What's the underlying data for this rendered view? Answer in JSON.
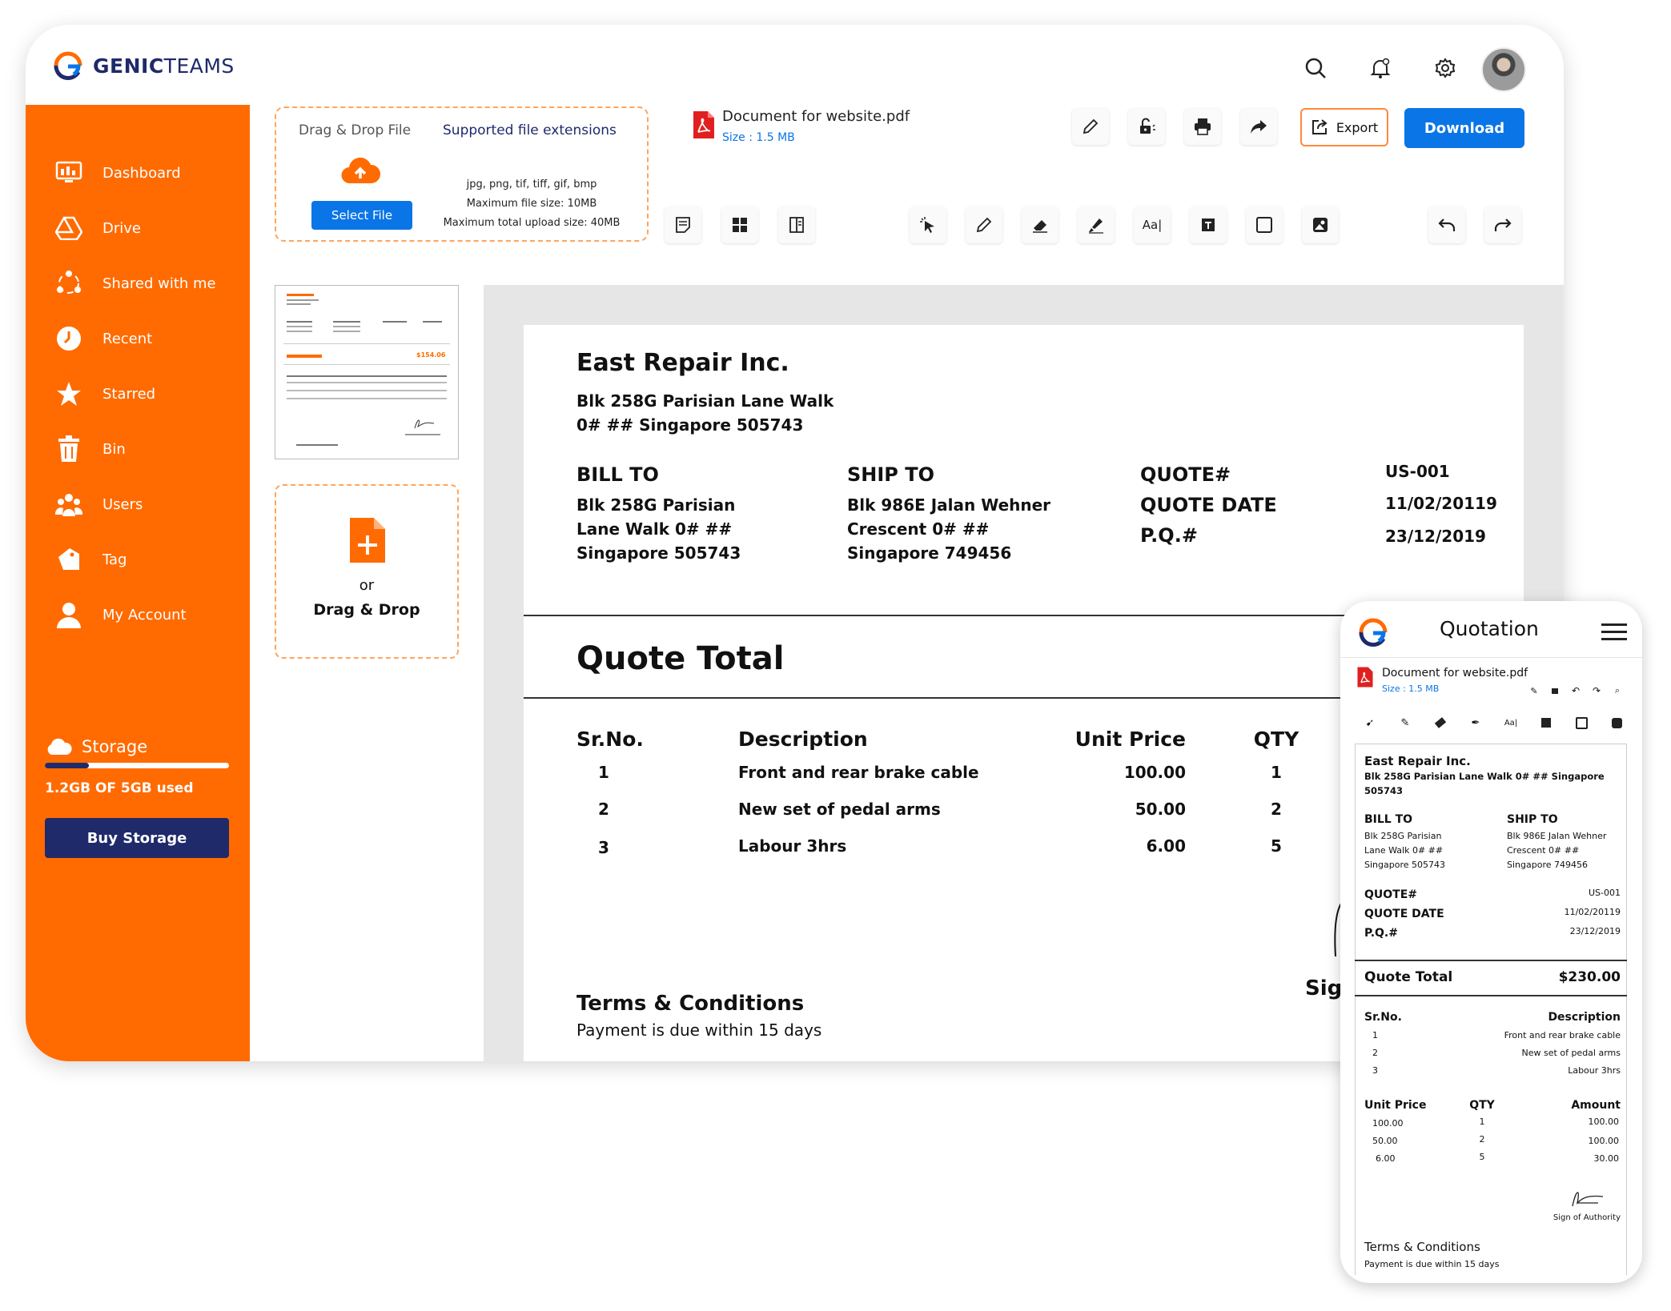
{
  "brand": {
    "name_bold": "GENIC",
    "name_light": "TEAMS",
    "accent": "#ff6b00",
    "navy": "#1f2a6b",
    "blue": "#0a75e6"
  },
  "topbar": {
    "icons": [
      "search-icon",
      "notification-bell-icon",
      "settings-gear-icon",
      "user-avatar"
    ]
  },
  "sidebar": {
    "items": [
      {
        "label": "Dashboard",
        "icon": "dashboard-icon"
      },
      {
        "label": "Drive",
        "icon": "drive-icon"
      },
      {
        "label": "Shared with me",
        "icon": "shared-icon"
      },
      {
        "label": "Recent",
        "icon": "clock-icon"
      },
      {
        "label": "Starred",
        "icon": "star-icon"
      },
      {
        "label": "Bin",
        "icon": "trash-icon"
      },
      {
        "label": "Users",
        "icon": "users-icon"
      },
      {
        "label": "Tag",
        "icon": "tag-icon"
      },
      {
        "label": "My Account",
        "icon": "account-icon"
      }
    ],
    "storage": {
      "title": "Storage",
      "used_text": "1.2GB OF 5GB used",
      "used_fraction": 0.24,
      "buy_label": "Buy Storage"
    }
  },
  "upload": {
    "drag_label": "Drag & Drop File",
    "supported_label": "Supported file extensions",
    "select_label": "Select File",
    "extensions": "jpg, png, tif, tiff, gif, bmp",
    "max_file": "Maximum file size: 10MB",
    "max_total": "Maximum total upload size: 40MB"
  },
  "document": {
    "name": "Document for website.pdf",
    "size": "Size : 1.5 MB"
  },
  "toolbar": {
    "export_label": "Export",
    "download_label": "Download"
  },
  "dropzone": {
    "or": "or",
    "label": "Drag & Drop"
  },
  "quote": {
    "company": "East Repair Inc.",
    "address1": "Blk 258G Parisian Lane Walk",
    "address2": "0# ## Singapore 505743",
    "bill_to_title": "BILL TO",
    "bill_to": [
      "Blk 258G Parisian",
      "Lane Walk 0# ##",
      "Singapore 505743"
    ],
    "ship_to_title": "SHIP TO",
    "ship_to": [
      "Blk 986E Jalan Wehner",
      "Crescent 0# ##",
      "Singapore 749456"
    ],
    "meta_labels": [
      "QUOTE#",
      "QUOTE DATE",
      "P.Q.#"
    ],
    "meta_values": [
      "US-001",
      "11/02/20119",
      "23/12/2019"
    ],
    "total_title": "Quote Total",
    "total_value": "$230.00",
    "headers": [
      "Sr.No.",
      "Description",
      "Unit Price",
      "QTY",
      "Amount"
    ],
    "rows": [
      [
        "1",
        "Front and rear brake cable",
        "100.00",
        "1",
        "100.00"
      ],
      [
        "2",
        "New set of pedal arms",
        "50.00",
        "2",
        "100.00"
      ],
      [
        "3",
        "Labour 3hrs",
        "6.00",
        "5",
        "30.00"
      ]
    ],
    "sign_partial": "Sign",
    "sign_label": "Sign of Authority",
    "terms_title": "Terms & Conditions",
    "terms_text": "Payment is due within 15 days"
  },
  "thumb": {
    "total_value": "$154.06"
  },
  "mobile": {
    "title": "Quotation"
  }
}
